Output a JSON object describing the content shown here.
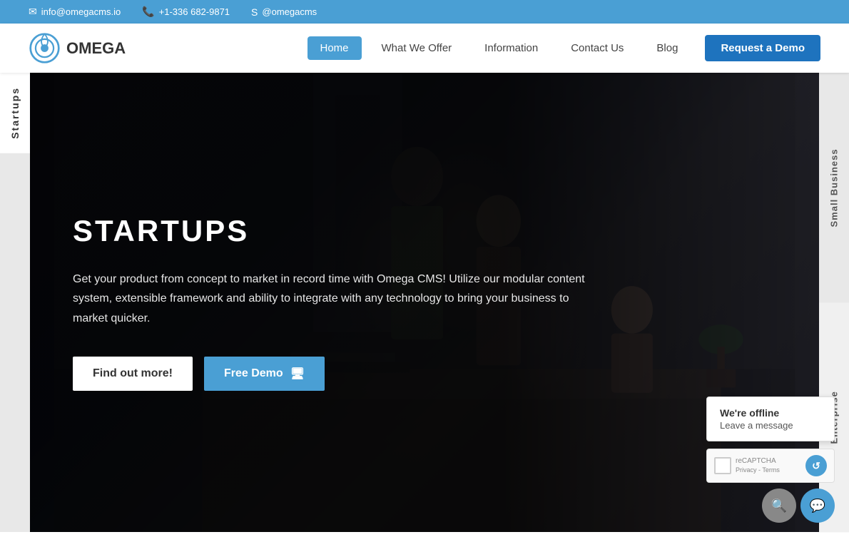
{
  "topbar": {
    "email": "info@omegacms.io",
    "phone": "+1-336 682-9871",
    "skype": "@omegacms",
    "email_icon": "✉",
    "phone_icon": "📞",
    "skype_icon": "S"
  },
  "navbar": {
    "logo_text": "OMEGA",
    "nav_items": [
      {
        "label": "Home",
        "active": true
      },
      {
        "label": "What We Offer",
        "active": false
      },
      {
        "label": "Information",
        "active": false
      },
      {
        "label": "Contact Us",
        "active": false
      },
      {
        "label": "Blog",
        "active": false
      }
    ],
    "demo_button": "Request a Demo"
  },
  "side_tabs": {
    "left": "Startups",
    "right_top": "Small Business",
    "right_bottom": "Enterprise"
  },
  "hero": {
    "title": "STARTUPS",
    "description": "Get your product from concept to market in record time with Omega CMS! Utilize our modular content system, extensible framework and ability to integrate with any technology to bring your business to market quicker.",
    "find_out_more": "Find out more!",
    "free_demo": "Free Demo",
    "demo_icon": "🖥"
  },
  "chat": {
    "status": "We're offline",
    "action": "Leave a message",
    "recaptcha_text": "reCAPTCHA\nPrivacy - Terms"
  }
}
